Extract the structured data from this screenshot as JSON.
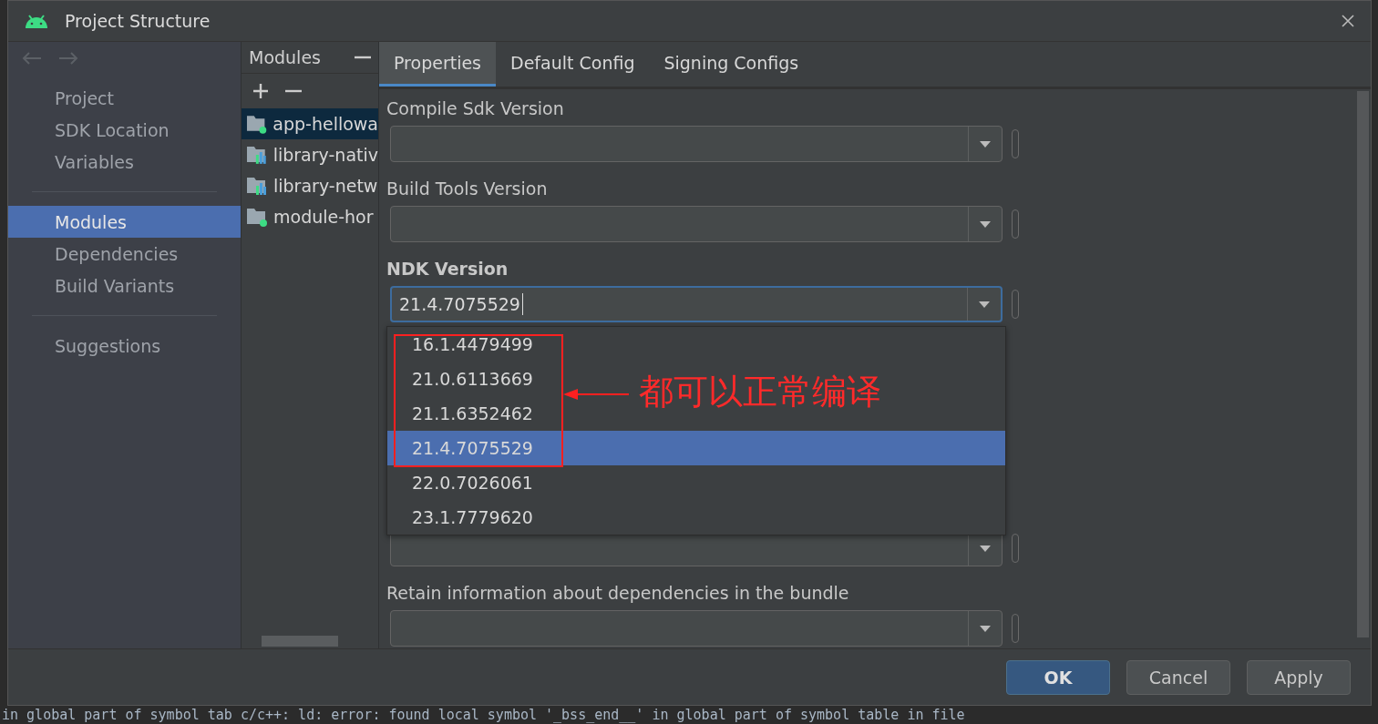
{
  "window": {
    "title": "Project Structure"
  },
  "sidebar": {
    "groups": [
      [
        {
          "label": "Project",
          "selected": false
        },
        {
          "label": "SDK Location",
          "selected": false
        },
        {
          "label": "Variables",
          "selected": false
        }
      ],
      [
        {
          "label": "Modules",
          "selected": true
        },
        {
          "label": "Dependencies",
          "selected": false
        },
        {
          "label": "Build Variants",
          "selected": false
        }
      ],
      [
        {
          "label": "Suggestions",
          "selected": false
        }
      ]
    ]
  },
  "modules": {
    "title": "Modules",
    "items": [
      {
        "label": "app-hellowa",
        "kind": "app",
        "selected": true
      },
      {
        "label": "library-nativ",
        "kind": "library",
        "selected": false
      },
      {
        "label": "library-netw",
        "kind": "library",
        "selected": false
      },
      {
        "label": "module-hor",
        "kind": "app",
        "selected": false
      }
    ]
  },
  "tabs": [
    {
      "label": "Properties",
      "selected": true
    },
    {
      "label": "Default Config",
      "selected": false
    },
    {
      "label": "Signing Configs",
      "selected": false
    }
  ],
  "fields": [
    {
      "label": "Compile Sdk Version",
      "bold": false,
      "focused": false
    },
    {
      "label": "Build Tools Version",
      "bold": false,
      "focused": false
    },
    {
      "label": "NDK Version",
      "bold": true,
      "value": "21.4.7075529",
      "focused": true
    },
    {
      "focused": false
    },
    {
      "label": "Retain information about dependencies in the bundle",
      "bold": false,
      "focused": false
    }
  ],
  "dropdown": {
    "items": [
      {
        "label": "16.1.4479499",
        "selected": false
      },
      {
        "label": "21.0.6113669",
        "selected": false
      },
      {
        "label": "21.1.6352462",
        "selected": false
      },
      {
        "label": "21.4.7075529",
        "selected": true
      },
      {
        "label": "22.0.7026061",
        "selected": false
      },
      {
        "label": "23.1.7779620",
        "selected": false
      }
    ]
  },
  "annotation": {
    "text": "都可以正常编译"
  },
  "buttons": [
    {
      "label": "OK",
      "primary": true
    },
    {
      "label": "Cancel",
      "primary": false
    },
    {
      "label": "Apply",
      "primary": false
    }
  ],
  "console_line": "in global part of symbol tab  c/c++:  ld: error: found local symbol '_bss_end__' in global part of symbol table in file"
}
